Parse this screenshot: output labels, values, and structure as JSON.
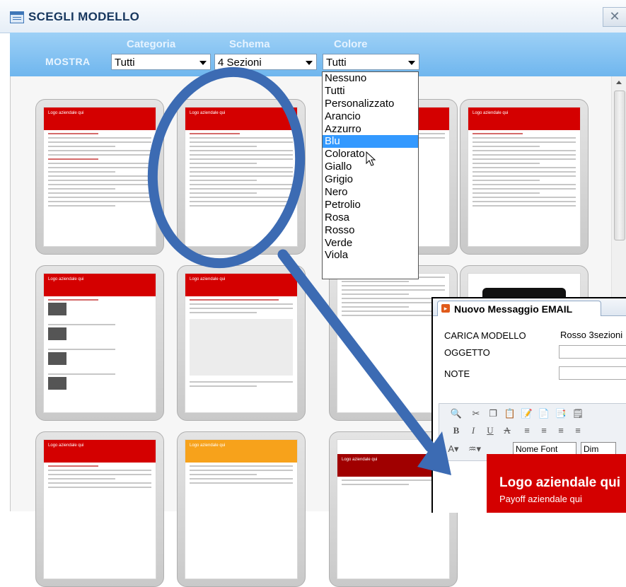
{
  "window": {
    "title": "SCEGLI MODELLO",
    "close_label": "✕"
  },
  "filters": {
    "mostra_label": "MOSTRA",
    "categoria": {
      "label": "Categoria",
      "value": "Tutti"
    },
    "schema": {
      "label": "Schema",
      "value": "4 Sezioni"
    },
    "colore": {
      "label": "Colore",
      "value": "Tutti"
    }
  },
  "colore_options": [
    "Nessuno",
    "Tutti",
    "Personalizzato",
    "Arancio",
    "Azzurro",
    "Blu",
    "Colorato",
    "Giallo",
    "Grigio",
    "Nero",
    "Petrolio",
    "Rosa",
    "Rosso",
    "Verde",
    "Viola"
  ],
  "colore_hover": "Blu",
  "template_logo_text": "Logo aziendale qui",
  "email_window": {
    "title": "Nuovo Messaggio EMAIL",
    "fields": {
      "carica_modello": {
        "label": "CARICA MODELLO",
        "value": "Rosso 3sezioni"
      },
      "oggetto": {
        "label": "OGGETTO",
        "value": ""
      },
      "note": {
        "label": "NOTE",
        "value": ""
      }
    },
    "font_select": "Nome Font",
    "size_select": "Dim",
    "banner_title": "Logo aziendale qui",
    "banner_subtitle": "Payoff aziendale qui"
  },
  "colors": {
    "accent_red": "#d40000",
    "filter_bar": "#7fc0f0",
    "annotation_blue": "#3c6bb3"
  }
}
